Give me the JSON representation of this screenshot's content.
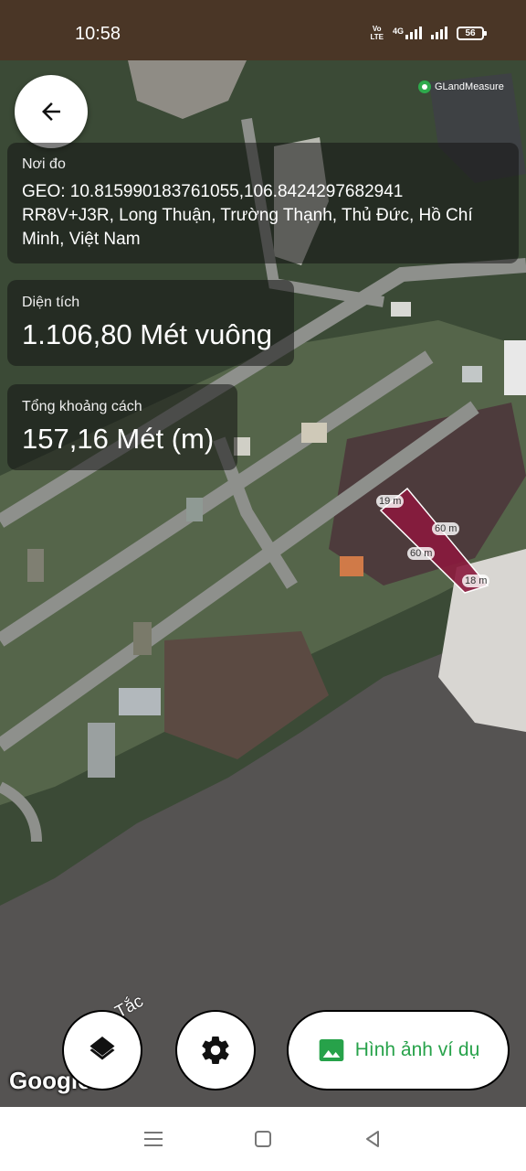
{
  "status_bar": {
    "time": "10:58",
    "volte_top": "Vo",
    "volte_bottom": "LTE",
    "network": "4G",
    "battery": "56"
  },
  "map": {
    "brand": "GLandMeasure",
    "road_label": "Tắc",
    "google_logo": "Google",
    "plot_color": "#8b1a3d",
    "dimensions": [
      "19 m",
      "60 m",
      "60 m",
      "18 m"
    ]
  },
  "location_card": {
    "label": "Nơi đo",
    "geo": "GEO: 10.815990183761055,106.8424297682941",
    "address": "RR8V+J3R, Long Thuận, Trường Thạnh, Thủ Đức, Hồ Chí Minh, Việt Nam"
  },
  "area_card": {
    "label": "Diện tích",
    "value": "1.106,80 Mét vuông"
  },
  "distance_card": {
    "label": "Tổng khoảng cách",
    "value": "157,16 Mét (m)"
  },
  "actions": {
    "example_label": "Hình ảnh ví dụ",
    "accent": "#27a24a"
  }
}
